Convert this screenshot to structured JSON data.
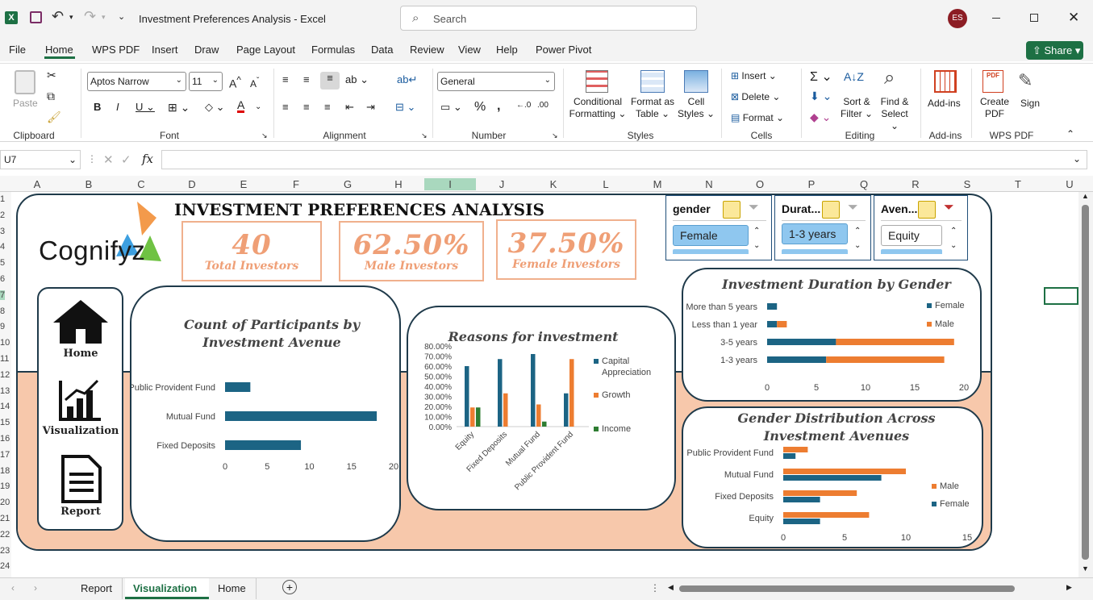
{
  "window": {
    "title": "Investment Preferences Analysis  -  Excel",
    "search_placeholder": "Search",
    "user_initials": "ES",
    "share": "Share"
  },
  "menu": [
    "File",
    "Home",
    "WPS PDF",
    "Insert",
    "Draw",
    "Page Layout",
    "Formulas",
    "Data",
    "Review",
    "View",
    "Help",
    "Power Pivot"
  ],
  "ribbon": {
    "clipboard": {
      "label": "Clipboard",
      "paste": "Paste"
    },
    "font": {
      "label": "Font",
      "name": "Aptos Narrow",
      "size": "11"
    },
    "alignment": {
      "label": "Alignment"
    },
    "number": {
      "label": "Number",
      "format": "General"
    },
    "styles": {
      "label": "Styles",
      "conditional": "Conditional",
      "conditional2": "Formatting",
      "format_as": "Format as",
      "format_as2": "Table",
      "cell": "Cell",
      "cell2": "Styles"
    },
    "cells": {
      "label": "Cells",
      "insert": "Insert",
      "delete": "Delete",
      "format": "Format"
    },
    "editing": {
      "label": "Editing",
      "sort": "Sort &",
      "sort2": "Filter",
      "find": "Find &",
      "find2": "Select"
    },
    "addins": {
      "label": "Add-ins",
      "btn": "Add-ins"
    },
    "wps": {
      "label": "WPS PDF",
      "create": "Create",
      "create2": "PDF",
      "sign": "Sign"
    }
  },
  "formula_bar": {
    "name_box": "U7",
    "fx": "fx",
    "value": ""
  },
  "columns": [
    "A",
    "B",
    "C",
    "D",
    "E",
    "F",
    "G",
    "H",
    "I",
    "J",
    "K",
    "L",
    "M",
    "N",
    "O",
    "P",
    "Q",
    "R",
    "S",
    "T",
    "U"
  ],
  "rows": [
    "1",
    "2",
    "3",
    "4",
    "5",
    "6",
    "7",
    "8",
    "9",
    "10",
    "11",
    "12",
    "13",
    "14",
    "15",
    "16",
    "17",
    "18",
    "19",
    "20",
    "21",
    "22",
    "23",
    "24"
  ],
  "dashboard": {
    "title": "INVESTMENT PREFERENCES ANALYSIS",
    "logo": "Cognifyz",
    "kpis": [
      {
        "value": "40",
        "label": "Total Investors"
      },
      {
        "value": "62.50%",
        "label": "Male Investors"
      },
      {
        "value": "37.50%",
        "label": "Female Investors"
      }
    ],
    "nav": {
      "home": "Home",
      "visualization": "Visualization",
      "report": "Report"
    },
    "slicers": [
      {
        "header": "gender",
        "item": "Female"
      },
      {
        "header": "Durat...",
        "item": "1-3 years"
      },
      {
        "header": "Aven...",
        "item": "Equity"
      }
    ]
  },
  "chart_data": [
    {
      "type": "bar",
      "title": "Count of Participants by Investment Avenue",
      "categories": [
        "Fixed Deposits",
        "Mutual Fund",
        "Public Provident Fund"
      ],
      "values": [
        9,
        18,
        3
      ],
      "xlim": [
        0,
        20
      ],
      "xticks": [
        "0",
        "5",
        "10",
        "15",
        "20"
      ],
      "color": "#1c6484"
    },
    {
      "type": "bar",
      "title": "Reasons for investment",
      "categories": [
        "Equity",
        "Fixed Deposits",
        "Mutual Fund",
        "Public Provident Fund"
      ],
      "series": [
        {
          "name": "Capital Appreciation",
          "values": [
            0.6,
            0.67,
            0.72,
            0.33
          ],
          "color": "#1c6484"
        },
        {
          "name": "Growth",
          "values": [
            0.19,
            0.33,
            0.22,
            0.67
          ],
          "color": "#ed7d31"
        },
        {
          "name": "Income",
          "values": [
            0.19,
            0.0,
            0.05,
            0.0
          ],
          "color": "#2e7d32"
        }
      ],
      "ylim": [
        0,
        0.8
      ],
      "yticks": [
        "0.00%",
        "10.00%",
        "20.00%",
        "30.00%",
        "40.00%",
        "50.00%",
        "60.00%",
        "70.00%",
        "80.00%"
      ]
    },
    {
      "type": "bar",
      "title": "Investment Duration by Gender",
      "categories": [
        "1-3 years",
        "3-5 years",
        "Less than 1 year",
        "More than 5 years"
      ],
      "series": [
        {
          "name": "Female",
          "values": [
            6,
            7,
            1,
            1
          ],
          "color": "#1c6484"
        },
        {
          "name": "Male",
          "values": [
            12,
            12,
            1,
            0
          ],
          "color": "#ed7d31"
        }
      ],
      "stacked": true,
      "xlim": [
        0,
        20
      ],
      "xticks": [
        "0",
        "5",
        "10",
        "15",
        "20"
      ]
    },
    {
      "type": "bar",
      "title": "Gender Distribution Across Investment Avenues",
      "categories": [
        "Equity",
        "Fixed Deposits",
        "Mutual Fund",
        "Public Provident Fund"
      ],
      "series": [
        {
          "name": "Female",
          "values": [
            3,
            3,
            8,
            1
          ],
          "color": "#1c6484"
        },
        {
          "name": "Male",
          "values": [
            7,
            6,
            10,
            2
          ],
          "color": "#ed7d31"
        }
      ],
      "xlim": [
        0,
        15
      ],
      "xticks": [
        "0",
        "5",
        "10",
        "15"
      ],
      "legend_order": [
        "Male",
        "Female"
      ]
    }
  ],
  "sheet_tabs": [
    "Report",
    "Visualization",
    "Home"
  ],
  "active_tab": "Visualization"
}
